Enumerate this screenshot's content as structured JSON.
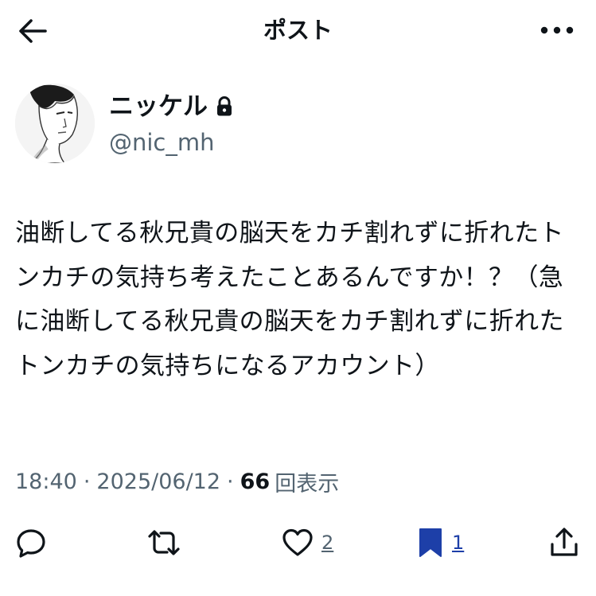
{
  "header": {
    "title": "ポスト"
  },
  "user": {
    "display_name": "ニッケル",
    "handle": "@nic_mh",
    "protected": true
  },
  "tweet": {
    "text": "油断してる秋兄貴の脳天をカチ割れずに折れたトンカチの気持ち考えたことあるんですか！？（急に油断してる秋兄貴の脳天をカチ割れずに折れたトンカチの気持ちになるアカウント）",
    "time": "18:40",
    "separator": "·",
    "date": "2025/06/12",
    "views_count": "66",
    "views_label": "回表示"
  },
  "actions": {
    "reply_count": "",
    "retweet_count": "",
    "like_count": "2",
    "bookmark_count": "1"
  },
  "colors": {
    "text": "#0f1419",
    "secondary": "#536471",
    "bookmark_active": "#1d3fa8"
  },
  "icons": [
    "back-arrow-icon",
    "more-icon",
    "lock-icon",
    "reply-icon",
    "retweet-icon",
    "like-icon",
    "bookmark-icon",
    "share-icon"
  ]
}
